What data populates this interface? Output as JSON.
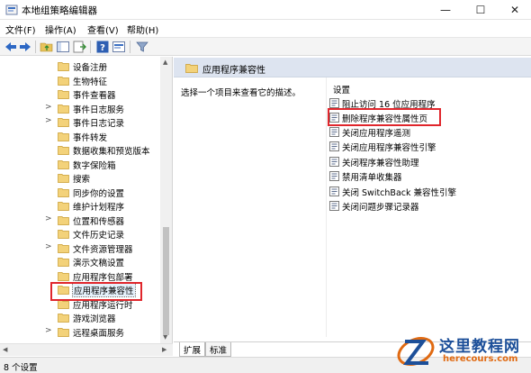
{
  "window": {
    "title": "本地组策略编辑器",
    "min": "—",
    "max": "☐",
    "close": "✕"
  },
  "menu": [
    "文件(F)",
    "操作(A)",
    "查看(V)",
    "帮助(H)"
  ],
  "tree": [
    {
      "label": "设备注册",
      "expandable": false
    },
    {
      "label": "生物特征",
      "expandable": false
    },
    {
      "label": "事件查看器",
      "expandable": false
    },
    {
      "label": "事件日志服务",
      "expandable": true
    },
    {
      "label": "事件日志记录",
      "expandable": true
    },
    {
      "label": "事件转发",
      "expandable": false
    },
    {
      "label": "数据收集和预览版本",
      "expandable": false
    },
    {
      "label": "数字保险箱",
      "expandable": false
    },
    {
      "label": "搜索",
      "expandable": false
    },
    {
      "label": "同步你的设置",
      "expandable": false
    },
    {
      "label": "维护计划程序",
      "expandable": false
    },
    {
      "label": "位置和传感器",
      "expandable": true
    },
    {
      "label": "文件历史记录",
      "expandable": false
    },
    {
      "label": "文件资源管理器",
      "expandable": true
    },
    {
      "label": "演示文稿设置",
      "expandable": false
    },
    {
      "label": "应用程序包部署",
      "expandable": false
    },
    {
      "label": "应用程序兼容性",
      "expandable": false,
      "selected": true
    },
    {
      "label": "应用程序运行时",
      "expandable": false
    },
    {
      "label": "游戏浏览器",
      "expandable": false
    },
    {
      "label": "远程桌面服务",
      "expandable": true
    }
  ],
  "detail": {
    "title": "应用程序兼容性",
    "description": "选择一个项目来查看它的描述。",
    "column_header": "设置",
    "policies": [
      "阻止访问 16 位应用程序",
      "删除程序兼容性属性页",
      "关闭应用程序遥测",
      "关闭应用程序兼容性引擎",
      "关闭程序兼容性助理",
      "禁用清单收集器",
      "关闭 SwitchBack 兼容性引擎",
      "关闭问题步骤记录器"
    ]
  },
  "tabs": [
    "扩展",
    "标准"
  ],
  "status": "8 个设置",
  "watermark": {
    "name": "这里教程网",
    "url": "herecours.com"
  }
}
